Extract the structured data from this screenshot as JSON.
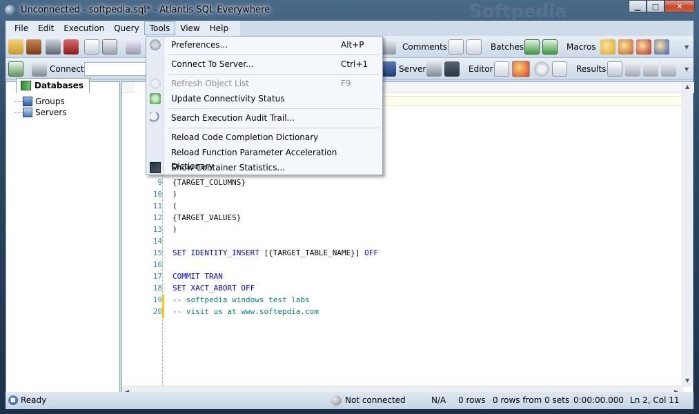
{
  "window": {
    "title": "Unconnected - softpedia.sql* - Atlantis SQL Everywhere",
    "watermark": "Softpedia",
    "min_label": "▁",
    "max_label": "□",
    "close_label": "✕"
  },
  "menubar": {
    "items": [
      "File",
      "Edit",
      "Execution",
      "Query",
      "Tools",
      "View",
      "Help"
    ],
    "active": "Tools"
  },
  "toolbar": {
    "comments_label": "Comments",
    "batches_label": "Batches",
    "macros_label": "Macros",
    "connect_label": "Connect",
    "server_label": "Server",
    "editor_label": "Editor",
    "results_label": "Results"
  },
  "left_panel": {
    "tab_label": "Databases",
    "tree": [
      {
        "label": "Groups",
        "icon": "groups-icon"
      },
      {
        "label": "Servers",
        "icon": "servers-icon"
      }
    ]
  },
  "tools_menu": {
    "items": [
      {
        "label": "Preferences...",
        "shortcut": "Alt+P",
        "icon": "preferences-icon",
        "enabled": true
      },
      {
        "label": "Connect To Server...",
        "shortcut": "Ctrl+1",
        "icon": "",
        "enabled": true
      },
      {
        "label": "Refresh Object List",
        "shortcut": "F9",
        "icon": "refresh-icon",
        "enabled": false
      },
      {
        "label": "Update Connectivity Status",
        "shortcut": "",
        "icon": "connectivity-icon",
        "enabled": true
      },
      {
        "label": "Search Execution Audit Trail...",
        "shortcut": "",
        "icon": "search-icon",
        "enabled": true
      },
      {
        "label": "Reload Code Completion Dictionary",
        "shortcut": "",
        "icon": "",
        "enabled": true
      },
      {
        "label": "Reload Function Parameter Acceleration Dictionary",
        "shortcut": "",
        "icon": "",
        "enabled": true
      },
      {
        "label": "Show Container Statistics...",
        "shortcut": "",
        "icon": "statistics-icon",
        "enabled": true
      }
    ]
  },
  "editor": {
    "lines": [
      {
        "num": "9",
        "text": "{TARGET_COLUMNS}",
        "style": "plain"
      },
      {
        "num": "10",
        "text": ")",
        "style": "plain"
      },
      {
        "num": "11",
        "text": "(",
        "style": "plain"
      },
      {
        "num": "12",
        "text": "{TARGET_VALUES}",
        "style": "plain"
      },
      {
        "num": "13",
        "text": ")",
        "style": "plain"
      },
      {
        "num": "14",
        "text": "",
        "style": "plain"
      },
      {
        "num": "15",
        "text_kw1": "SET IDENTITY_INSERT",
        "text_mid": " [{TARGET_TABLE_NAME}] ",
        "text_kw2": "OFF",
        "style": "mixed"
      },
      {
        "num": "16",
        "text": "",
        "style": "plain"
      },
      {
        "num": "17",
        "text": "COMMIT TRAN",
        "style": "kw"
      },
      {
        "num": "18",
        "text": "SET XACT_ABORT OFF",
        "style": "kw"
      },
      {
        "num": "19",
        "text": "-- softpedia windows test labs",
        "style": "cm"
      },
      {
        "num": "20",
        "text": "-- visit us at www.softepdia.com",
        "style": "cm"
      }
    ]
  },
  "status": {
    "ready": "Ready",
    "connection": "Not connected",
    "na": "N/A",
    "rows": "0 rows",
    "rows_sets": "0 rows from 0 sets",
    "time": "0:00:00.000",
    "position": "Ln 2, Col 11"
  }
}
